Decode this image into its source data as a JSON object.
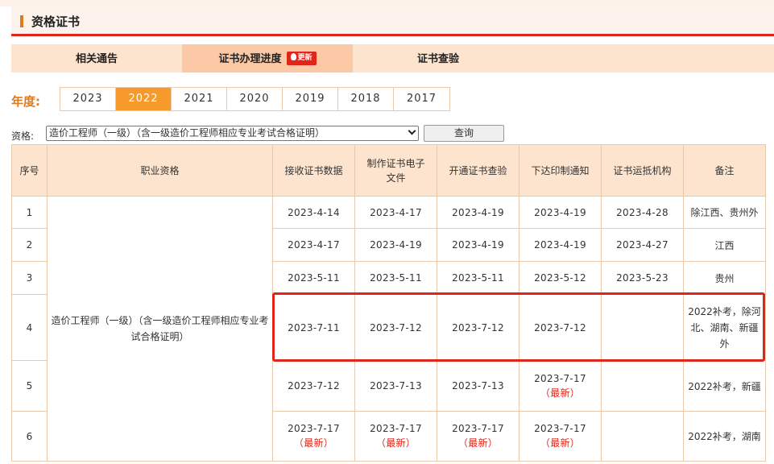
{
  "section": {
    "title": "资格证书"
  },
  "tabs": [
    {
      "label": "相关通告"
    },
    {
      "label": "证书办理进度",
      "badge": "更新"
    },
    {
      "label": "证书查验"
    }
  ],
  "filters": {
    "year_label": "年度:",
    "years": [
      "2023",
      "2022",
      "2021",
      "2020",
      "2019",
      "2018",
      "2017"
    ],
    "selected_year": "2022",
    "qualification_label": "资格:",
    "qualification_value": "造价工程师（一级）（含一级造价工程师相应专业考试合格证明）",
    "query_button": "查询"
  },
  "table": {
    "headers": [
      "序号",
      "职业资格",
      "接收证书数据",
      "制作证书电子文件",
      "开通证书查验",
      "下达印制通知",
      "证书运抵机构",
      "备注"
    ],
    "qualification_cell": "造价工程师（一级）（含一级造价工程师相应专业考试合格证明）",
    "newest_label": "（最新）",
    "rows": [
      {
        "no": "1",
        "receive": "2023-4-14",
        "make": "2023-4-17",
        "verify": "2023-4-19",
        "print": "2023-4-19",
        "arrive": "2023-4-28",
        "note": "除江西、贵州外"
      },
      {
        "no": "2",
        "receive": "2023-4-17",
        "make": "2023-4-19",
        "verify": "2023-4-19",
        "print": "2023-4-19",
        "arrive": "2023-4-27",
        "note": "江西"
      },
      {
        "no": "3",
        "receive": "2023-5-11",
        "make": "2023-5-11",
        "verify": "2023-5-11",
        "print": "2023-5-12",
        "arrive": "2023-5-23",
        "note": "贵州"
      },
      {
        "no": "4",
        "receive": "2023-7-11",
        "make": "2023-7-12",
        "verify": "2023-7-12",
        "print": "2023-7-12",
        "arrive": "",
        "note": "2022补考，除河北、湖南、新疆外"
      },
      {
        "no": "5",
        "receive": "2023-7-12",
        "make": "2023-7-13",
        "verify": "2023-7-13",
        "print": "2023-7-17",
        "arrive": "",
        "note": "2022补考，新疆"
      },
      {
        "no": "6",
        "receive": "2023-7-17",
        "make": "2023-7-17",
        "verify": "2023-7-17",
        "print": "2023-7-17",
        "arrive": "",
        "note": "2022补考，湖南"
      }
    ]
  }
}
